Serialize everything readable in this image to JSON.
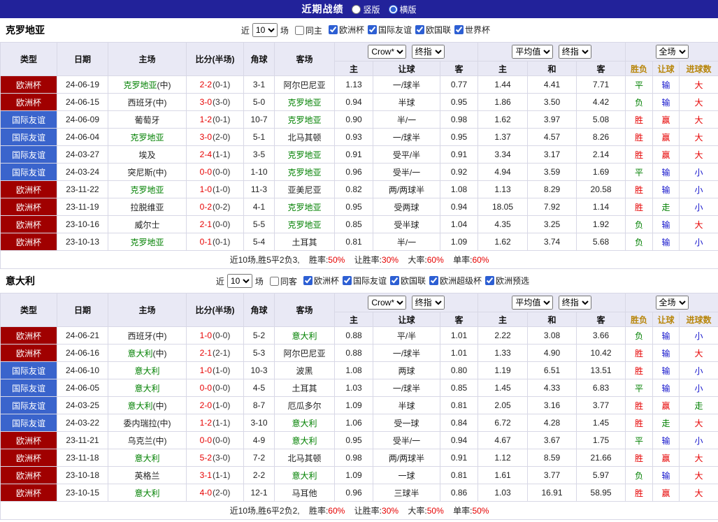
{
  "header": {
    "title": "近期战绩",
    "radio_vertical": "竖版",
    "radio_horizontal": "横版"
  },
  "table_header": {
    "col_type": "类型",
    "col_date": "日期",
    "col_home": "主场",
    "col_score": "比分(半场)",
    "col_corner": "角球",
    "col_away": "客场",
    "odds_select": "Crow*",
    "odds_final_select": "终指",
    "avg_select": "平均值",
    "avg_final_select": "终指",
    "full_select": "全场",
    "sub_odds_home": "主",
    "sub_odds_handicap": "让球",
    "sub_odds_away": "客",
    "sub_avg_home": "主",
    "sub_avg_draw": "和",
    "sub_avg_away": "客",
    "sub_result": "胜负",
    "sub_handicap_result": "让球",
    "sub_goals": "进球数"
  },
  "colors": {
    "topbar": "#22229a",
    "type_cup_red": "#a00000",
    "type_friendly_blue": "#3a64cc",
    "team_highlight_green": "#008000",
    "win_red": "#e60000",
    "draw_green": "#008000",
    "lose_blue": "#1414cc",
    "header_bg": "#e9e9f5",
    "gold_header": "#b8860b"
  },
  "sections": [
    {
      "team": "克罗地亚",
      "filter": {
        "near_label": "近",
        "count": "10",
        "games_label": "场",
        "same_label": "同主",
        "same_checked": false,
        "competitions": [
          {
            "label": "欧洲杯",
            "checked": true
          },
          {
            "label": "国际友谊",
            "checked": true
          },
          {
            "label": "欧国联",
            "checked": true
          },
          {
            "label": "世界杯",
            "checked": true
          }
        ]
      },
      "rows": [
        {
          "type": "欧洲杯",
          "type_color": "red",
          "date": "24-06-19",
          "home": "克罗地亚",
          "home_suffix": "(中)",
          "home_green": true,
          "score_ft": "2-2",
          "score_ht": "(0-1)",
          "corner": "3-1",
          "away": "阿尔巴尼亚",
          "away_green": false,
          "odds_home": "1.13",
          "handicap": "一/球半",
          "odds_away": "0.77",
          "avg_home": "1.44",
          "avg_draw": "4.41",
          "avg_away": "7.71",
          "result": "平",
          "result_color": "green",
          "hresult": "输",
          "hresult_color": "blue",
          "gresult": "大",
          "gresult_color": "red"
        },
        {
          "type": "欧洲杯",
          "type_color": "red",
          "date": "24-06-15",
          "home": "西班牙",
          "home_suffix": "(中)",
          "home_green": false,
          "score_ft": "3-0",
          "score_ht": "(3-0)",
          "corner": "5-0",
          "away": "克罗地亚",
          "away_green": true,
          "odds_home": "0.94",
          "handicap": "半球",
          "odds_away": "0.95",
          "avg_home": "1.86",
          "avg_draw": "3.50",
          "avg_away": "4.42",
          "result": "负",
          "result_color": "green",
          "hresult": "输",
          "hresult_color": "blue",
          "gresult": "大",
          "gresult_color": "red"
        },
        {
          "type": "国际友谊",
          "type_color": "blue",
          "date": "24-06-09",
          "home": "葡萄牙",
          "home_suffix": "",
          "home_green": false,
          "score_ft": "1-2",
          "score_ht": "(0-1)",
          "corner": "10-7",
          "away": "克罗地亚",
          "away_green": true,
          "odds_home": "0.90",
          "handicap": "半/一",
          "odds_away": "0.98",
          "avg_home": "1.62",
          "avg_draw": "3.97",
          "avg_away": "5.08",
          "result": "胜",
          "result_color": "red",
          "hresult": "赢",
          "hresult_color": "red",
          "gresult": "大",
          "gresult_color": "red"
        },
        {
          "type": "国际友谊",
          "type_color": "blue",
          "date": "24-06-04",
          "home": "克罗地亚",
          "home_suffix": "",
          "home_green": true,
          "score_ft": "3-0",
          "score_ht": "(2-0)",
          "corner": "5-1",
          "away": "北马其顿",
          "away_green": false,
          "odds_home": "0.93",
          "handicap": "一/球半",
          "odds_away": "0.95",
          "avg_home": "1.37",
          "avg_draw": "4.57",
          "avg_away": "8.26",
          "result": "胜",
          "result_color": "red",
          "hresult": "赢",
          "hresult_color": "red",
          "gresult": "大",
          "gresult_color": "red"
        },
        {
          "type": "国际友谊",
          "type_color": "blue",
          "date": "24-03-27",
          "home": "埃及",
          "home_suffix": "",
          "home_green": false,
          "score_ft": "2-4",
          "score_ht": "(1-1)",
          "corner": "3-5",
          "away": "克罗地亚",
          "away_green": true,
          "odds_home": "0.91",
          "handicap": "受平/半",
          "odds_away": "0.91",
          "avg_home": "3.34",
          "avg_draw": "3.17",
          "avg_away": "2.14",
          "result": "胜",
          "result_color": "red",
          "hresult": "赢",
          "hresult_color": "red",
          "gresult": "大",
          "gresult_color": "red"
        },
        {
          "type": "国际友谊",
          "type_color": "blue",
          "date": "24-03-24",
          "home": "突尼斯",
          "home_suffix": "(中)",
          "home_green": false,
          "score_ft": "0-0",
          "score_ht": "(0-0)",
          "corner": "1-10",
          "away": "克罗地亚",
          "away_green": true,
          "odds_home": "0.96",
          "handicap": "受半/一",
          "odds_away": "0.92",
          "avg_home": "4.94",
          "avg_draw": "3.59",
          "avg_away": "1.69",
          "result": "平",
          "result_color": "green",
          "hresult": "输",
          "hresult_color": "blue",
          "gresult": "小",
          "gresult_color": "blue"
        },
        {
          "type": "欧洲杯",
          "type_color": "red",
          "date": "23-11-22",
          "home": "克罗地亚",
          "home_suffix": "",
          "home_green": true,
          "score_ft": "1-0",
          "score_ht": "(1-0)",
          "corner": "11-3",
          "away": "亚美尼亚",
          "away_green": false,
          "odds_home": "0.82",
          "handicap": "两/两球半",
          "odds_away": "1.08",
          "avg_home": "1.13",
          "avg_draw": "8.29",
          "avg_away": "20.58",
          "result": "胜",
          "result_color": "red",
          "hresult": "输",
          "hresult_color": "blue",
          "gresult": "小",
          "gresult_color": "blue"
        },
        {
          "type": "欧洲杯",
          "type_color": "red",
          "date": "23-11-19",
          "home": "拉脱维亚",
          "home_suffix": "",
          "home_green": false,
          "score_ft": "0-2",
          "score_ht": "(0-2)",
          "corner": "4-1",
          "away": "克罗地亚",
          "away_green": true,
          "odds_home": "0.95",
          "handicap": "受两球",
          "odds_away": "0.94",
          "avg_home": "18.05",
          "avg_draw": "7.92",
          "avg_away": "1.14",
          "result": "胜",
          "result_color": "red",
          "hresult": "走",
          "hresult_color": "green",
          "gresult": "小",
          "gresult_color": "blue"
        },
        {
          "type": "欧洲杯",
          "type_color": "red",
          "date": "23-10-16",
          "home": "威尔士",
          "home_suffix": "",
          "home_green": false,
          "score_ft": "2-1",
          "score_ht": "(0-0)",
          "corner": "5-5",
          "away": "克罗地亚",
          "away_green": true,
          "odds_home": "0.85",
          "handicap": "受半球",
          "odds_away": "1.04",
          "avg_home": "4.35",
          "avg_draw": "3.25",
          "avg_away": "1.92",
          "result": "负",
          "result_color": "green",
          "hresult": "输",
          "hresult_color": "blue",
          "gresult": "大",
          "gresult_color": "red"
        },
        {
          "type": "欧洲杯",
          "type_color": "red",
          "date": "23-10-13",
          "home": "克罗地亚",
          "home_suffix": "",
          "home_green": true,
          "score_ft": "0-1",
          "score_ht": "(0-1)",
          "corner": "5-4",
          "away": "土耳其",
          "away_green": false,
          "odds_home": "0.81",
          "handicap": "半/一",
          "odds_away": "1.09",
          "avg_home": "1.62",
          "avg_draw": "3.74",
          "avg_away": "5.68",
          "result": "负",
          "result_color": "green",
          "hresult": "输",
          "hresult_color": "blue",
          "gresult": "小",
          "gresult_color": "blue"
        }
      ],
      "summary": {
        "record": "近10场,胜5平2负3,",
        "stat1_label": "胜率:",
        "stat1_value": "50%",
        "stat2_label": "让胜率:",
        "stat2_value": "30%",
        "stat3_label": "大率:",
        "stat3_value": "60%",
        "stat4_label": "单率:",
        "stat4_value": "60%"
      }
    },
    {
      "team": "意大利",
      "filter": {
        "near_label": "近",
        "count": "10",
        "games_label": "场",
        "same_label": "同客",
        "same_checked": false,
        "competitions": [
          {
            "label": "欧洲杯",
            "checked": true
          },
          {
            "label": "国际友谊",
            "checked": true
          },
          {
            "label": "欧国联",
            "checked": true
          },
          {
            "label": "欧洲超级杯",
            "checked": true
          },
          {
            "label": "欧洲预选",
            "checked": true
          }
        ]
      },
      "rows": [
        {
          "type": "欧洲杯",
          "type_color": "red",
          "date": "24-06-21",
          "home": "西班牙",
          "home_suffix": "(中)",
          "home_green": false,
          "score_ft": "1-0",
          "score_ht": "(0-0)",
          "corner": "5-2",
          "away": "意大利",
          "away_green": true,
          "odds_home": "0.88",
          "handicap": "平/半",
          "odds_away": "1.01",
          "avg_home": "2.22",
          "avg_draw": "3.08",
          "avg_away": "3.66",
          "result": "负",
          "result_color": "green",
          "hresult": "输",
          "hresult_color": "blue",
          "gresult": "小",
          "gresult_color": "blue"
        },
        {
          "type": "欧洲杯",
          "type_color": "red",
          "date": "24-06-16",
          "home": "意大利",
          "home_suffix": "(中)",
          "home_green": true,
          "score_ft": "2-1",
          "score_ht": "(2-1)",
          "corner": "5-3",
          "away": "阿尔巴尼亚",
          "away_green": false,
          "odds_home": "0.88",
          "handicap": "一/球半",
          "odds_away": "1.01",
          "avg_home": "1.33",
          "avg_draw": "4.90",
          "avg_away": "10.42",
          "result": "胜",
          "result_color": "red",
          "hresult": "输",
          "hresult_color": "blue",
          "gresult": "大",
          "gresult_color": "red"
        },
        {
          "type": "国际友谊",
          "type_color": "blue",
          "date": "24-06-10",
          "home": "意大利",
          "home_suffix": "",
          "home_green": true,
          "score_ft": "1-0",
          "score_ht": "(1-0)",
          "corner": "10-3",
          "away": "波黑",
          "away_green": false,
          "odds_home": "1.08",
          "handicap": "两球",
          "odds_away": "0.80",
          "avg_home": "1.19",
          "avg_draw": "6.51",
          "avg_away": "13.51",
          "result": "胜",
          "result_color": "red",
          "hresult": "输",
          "hresult_color": "blue",
          "gresult": "小",
          "gresult_color": "blue"
        },
        {
          "type": "国际友谊",
          "type_color": "blue",
          "date": "24-06-05",
          "home": "意大利",
          "home_suffix": "",
          "home_green": true,
          "score_ft": "0-0",
          "score_ht": "(0-0)",
          "corner": "4-5",
          "away": "土耳其",
          "away_green": false,
          "odds_home": "1.03",
          "handicap": "一/球半",
          "odds_away": "0.85",
          "avg_home": "1.45",
          "avg_draw": "4.33",
          "avg_away": "6.83",
          "result": "平",
          "result_color": "green",
          "hresult": "输",
          "hresult_color": "blue",
          "gresult": "小",
          "gresult_color": "blue"
        },
        {
          "type": "国际友谊",
          "type_color": "blue",
          "date": "24-03-25",
          "home": "意大利",
          "home_suffix": "(中)",
          "home_green": true,
          "score_ft": "2-0",
          "score_ht": "(1-0)",
          "corner": "8-7",
          "away": "厄瓜多尔",
          "away_green": false,
          "odds_home": "1.09",
          "handicap": "半球",
          "odds_away": "0.81",
          "avg_home": "2.05",
          "avg_draw": "3.16",
          "avg_away": "3.77",
          "result": "胜",
          "result_color": "red",
          "hresult": "赢",
          "hresult_color": "red",
          "gresult": "走",
          "gresult_color": "green"
        },
        {
          "type": "国际友谊",
          "type_color": "blue",
          "date": "24-03-22",
          "home": "委内瑞拉",
          "home_suffix": "(中)",
          "home_green": false,
          "score_ft": "1-2",
          "score_ht": "(1-1)",
          "corner": "3-10",
          "away": "意大利",
          "away_green": true,
          "odds_home": "1.06",
          "handicap": "受一球",
          "odds_away": "0.84",
          "avg_home": "6.72",
          "avg_draw": "4.28",
          "avg_away": "1.45",
          "result": "胜",
          "result_color": "red",
          "hresult": "走",
          "hresult_color": "green",
          "gresult": "大",
          "gresult_color": "red"
        },
        {
          "type": "欧洲杯",
          "type_color": "red",
          "date": "23-11-21",
          "home": "乌克兰",
          "home_suffix": "(中)",
          "home_green": false,
          "score_ft": "0-0",
          "score_ht": "(0-0)",
          "corner": "4-9",
          "away": "意大利",
          "away_green": true,
          "odds_home": "0.95",
          "handicap": "受半/一",
          "odds_away": "0.94",
          "avg_home": "4.67",
          "avg_draw": "3.67",
          "avg_away": "1.75",
          "result": "平",
          "result_color": "green",
          "hresult": "输",
          "hresult_color": "blue",
          "gresult": "小",
          "gresult_color": "blue"
        },
        {
          "type": "欧洲杯",
          "type_color": "red",
          "date": "23-11-18",
          "home": "意大利",
          "home_suffix": "",
          "home_green": true,
          "score_ft": "5-2",
          "score_ht": "(3-0)",
          "corner": "7-2",
          "away": "北马其顿",
          "away_green": false,
          "odds_home": "0.98",
          "handicap": "两/两球半",
          "odds_away": "0.91",
          "avg_home": "1.12",
          "avg_draw": "8.59",
          "avg_away": "21.66",
          "result": "胜",
          "result_color": "red",
          "hresult": "赢",
          "hresult_color": "red",
          "gresult": "大",
          "gresult_color": "red"
        },
        {
          "type": "欧洲杯",
          "type_color": "red",
          "date": "23-10-18",
          "home": "英格兰",
          "home_suffix": "",
          "home_green": false,
          "score_ft": "3-1",
          "score_ht": "(1-1)",
          "corner": "2-2",
          "away": "意大利",
          "away_green": true,
          "odds_home": "1.09",
          "handicap": "一球",
          "odds_away": "0.81",
          "avg_home": "1.61",
          "avg_draw": "3.77",
          "avg_away": "5.97",
          "result": "负",
          "result_color": "green",
          "hresult": "输",
          "hresult_color": "blue",
          "gresult": "大",
          "gresult_color": "red"
        },
        {
          "type": "欧洲杯",
          "type_color": "red",
          "date": "23-10-15",
          "home": "意大利",
          "home_suffix": "",
          "home_green": true,
          "score_ft": "4-0",
          "score_ht": "(2-0)",
          "corner": "12-1",
          "away": "马耳他",
          "away_green": false,
          "odds_home": "0.96",
          "handicap": "三球半",
          "odds_away": "0.86",
          "avg_home": "1.03",
          "avg_draw": "16.91",
          "avg_away": "58.95",
          "result": "胜",
          "result_color": "red",
          "hresult": "赢",
          "hresult_color": "red",
          "gresult": "大",
          "gresult_color": "red"
        }
      ],
      "summary": {
        "record": "近10场,胜6平2负2,",
        "stat1_label": "胜率:",
        "stat1_value": "60%",
        "stat2_label": "让胜率:",
        "stat2_value": "30%",
        "stat3_label": "大率:",
        "stat3_value": "50%",
        "stat4_label": "单率:",
        "stat4_value": "50%"
      }
    }
  ]
}
